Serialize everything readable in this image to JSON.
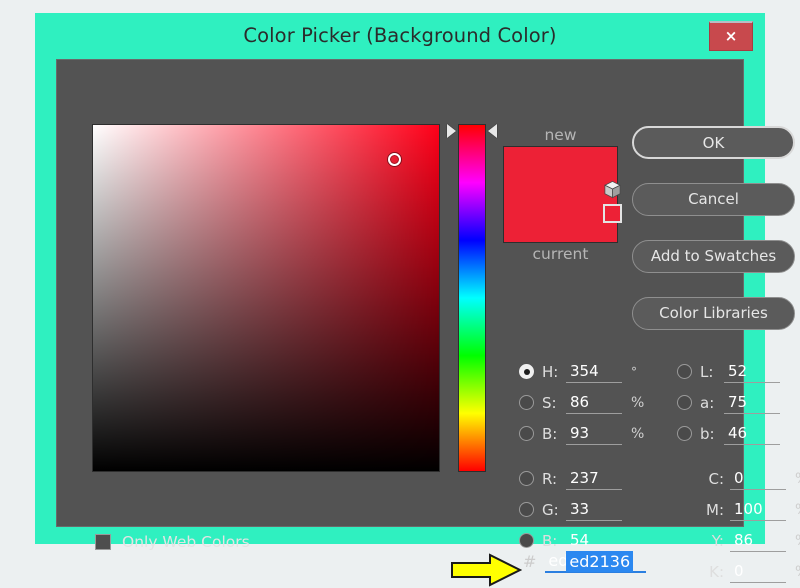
{
  "window": {
    "title": "Color Picker (Background Color)",
    "close_icon": "close-icon",
    "close_glyph": "×",
    "title_bar_color": "#2ff0c0",
    "page_background": "#ecf0f1",
    "dialog_background": "#535353"
  },
  "color": {
    "hex": "ed2136",
    "hash_symbol": "#",
    "new_label": "new",
    "current_label": "current",
    "new_swatch": "#ed2136",
    "current_swatch": "#ed2136",
    "gamut_swatch": "#ed2136",
    "cube_icon": "out-of-gamut-cube-icon",
    "hue_color": "#ff0019",
    "cursor_x_pct": 87,
    "cursor_y_pct": 10,
    "hue_marker_pct": 2
  },
  "buttons": [
    {
      "name": "ok-button",
      "label": "OK",
      "primary": true
    },
    {
      "name": "cancel-button",
      "label": "Cancel",
      "primary": false
    },
    {
      "name": "add-to-swatches-button",
      "label": "Add to Swatches",
      "primary": false
    },
    {
      "name": "color-libraries-button",
      "label": "Color Libraries",
      "primary": false
    }
  ],
  "hsb": [
    {
      "key": "H",
      "label": "H:",
      "value": "354",
      "unit": "°",
      "selected": true
    },
    {
      "key": "S",
      "label": "S:",
      "value": "86",
      "unit": "%",
      "selected": false
    },
    {
      "key": "B",
      "label": "B:",
      "value": "93",
      "unit": "%",
      "selected": false
    }
  ],
  "rgb": [
    {
      "key": "R",
      "label": "R:",
      "value": "237",
      "unit": "",
      "selected": false
    },
    {
      "key": "G",
      "label": "G:",
      "value": "33",
      "unit": "",
      "selected": false
    },
    {
      "key": "B",
      "label": "B:",
      "value": "54",
      "unit": "",
      "selected": false
    }
  ],
  "lab": [
    {
      "key": "L",
      "label": "L:",
      "value": "52",
      "unit": "",
      "selected": false
    },
    {
      "key": "a",
      "label": "a:",
      "value": "75",
      "unit": "",
      "selected": false
    },
    {
      "key": "b",
      "label": "b:",
      "value": "46",
      "unit": "",
      "selected": false
    }
  ],
  "cmyk": [
    {
      "key": "C",
      "label": "C:",
      "value": "0",
      "unit": "%"
    },
    {
      "key": "M",
      "label": "M:",
      "value": "100",
      "unit": "%"
    },
    {
      "key": "Y",
      "label": "Y:",
      "value": "86",
      "unit": "%"
    },
    {
      "key": "K",
      "label": "K:",
      "value": "0",
      "unit": "%"
    }
  ],
  "options": {
    "only_web_colors_label": "Only Web Colors",
    "only_web_colors_checked": false
  },
  "annotation": {
    "arrow_icon": "arrow-right-icon",
    "arrow_color": "#ffff00",
    "arrow_outline": "#1a1a1a"
  }
}
